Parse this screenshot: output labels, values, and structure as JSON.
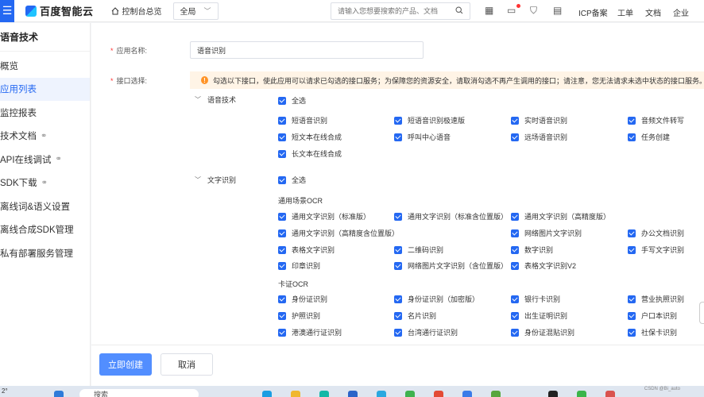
{
  "topbar": {
    "menu_icon": "menu-icon",
    "brand": "百度智能云",
    "home": "控制台总览",
    "region": "全局",
    "search_placeholder": "请输入您想要搜索的产品、文档",
    "links": [
      "ICP备案",
      "工单",
      "文档",
      "企业"
    ]
  },
  "sidebar": {
    "title": "语音技术",
    "items": [
      {
        "label": "概览",
        "active": false,
        "external": false
      },
      {
        "label": "应用列表",
        "active": true,
        "external": false
      },
      {
        "label": "监控报表",
        "active": false,
        "external": false
      },
      {
        "label": "技术文档",
        "active": false,
        "external": true
      },
      {
        "label": "API在线调试",
        "active": false,
        "external": true
      },
      {
        "label": "SDK下载",
        "active": false,
        "external": true
      },
      {
        "label": "离线词&语义设置",
        "active": false,
        "external": false
      },
      {
        "label": "离线合成SDK管理",
        "active": false,
        "external": false
      },
      {
        "label": "私有部署服务管理",
        "active": false,
        "external": false
      }
    ]
  },
  "form": {
    "app_name_label": "应用名称:",
    "app_name_value": "语音识别",
    "interface_label": "接口选择:",
    "warning": "勾选以下接口，使此应用可以请求已勾选的接口服务；为保障您的资源安全，请取消勾选不再产生调用的接口；请注意，您无法请求未选中状态的接口服务。",
    "speech": {
      "category": "语音技术",
      "select_all": "全选",
      "items": [
        "短语音识别",
        "短语音识别极速版",
        "实时语音识别",
        "音频文件转写",
        "短文本在线合成",
        "呼叫中心语音",
        "远场语音识别",
        "任务创建",
        "长文本在线合成"
      ]
    },
    "ocr": {
      "category": "文字识别",
      "select_all": "全选",
      "general_title": "通用场景OCR",
      "general_items": [
        "通用文字识别（标准版）",
        "通用文字识别（标准含位置版）",
        "通用文字识别（高精度版）",
        "通用文字识别（高精度含位置版）",
        "网络图片文字识别",
        "办公文档识别",
        "表格文字识别",
        "二维码识别",
        "数字识别",
        "手写文字识别",
        "印章识别",
        "网络图片文字识别（含位置版）",
        "表格文字识别V2"
      ],
      "card_title": "卡证OCR",
      "card_items": [
        "身份证识别",
        "身份证识别（加密版）",
        "银行卡识别",
        "营业执照识别",
        "护照识别",
        "名片识别",
        "出生证明识别",
        "户口本识别",
        "港澳通行证识别",
        "台湾通行证识别",
        "身份证混贴识别",
        "社保卡识别"
      ]
    }
  },
  "footer": {
    "create_label": "立即创建",
    "cancel_label": "取消"
  },
  "taskbar": {
    "search_text": "搜索",
    "left_text": "2°"
  },
  "watermark": "CSDN @Bi_auto"
}
